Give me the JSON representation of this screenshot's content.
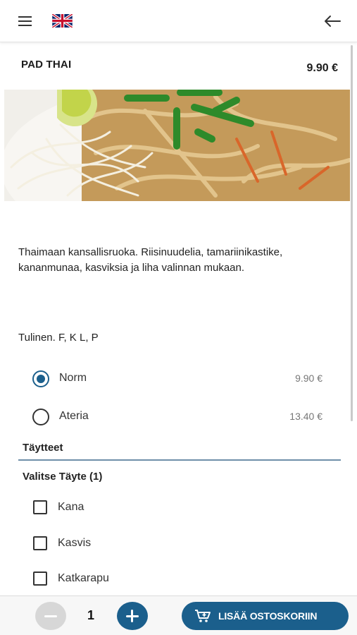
{
  "header": {
    "menu_icon": "hamburger-menu-icon",
    "language_icon": "uk-flag-icon",
    "back_icon": "arrow-left-icon"
  },
  "product": {
    "name": "PAD THAI",
    "price": "9.90 €",
    "description": "Thaimaan kansallisruoka. Riisinuudelia, tamariinikastike, kananmunaa, kasviksia ja liha valinnan mukaan.",
    "allergens": "Tulinen. F, K L, P"
  },
  "options": [
    {
      "label": "Norm",
      "price": "9.90 €",
      "selected": true
    },
    {
      "label": "Ateria",
      "price": "13.40 €",
      "selected": false
    }
  ],
  "fillings": {
    "section_title": "Täytteet",
    "group_title": "Valitse Täyte (1)",
    "items": [
      {
        "label": "Kana",
        "checked": false
      },
      {
        "label": "Kasvis",
        "checked": false
      },
      {
        "label": "Katkarapu",
        "checked": false
      }
    ]
  },
  "footer": {
    "quantity": "1",
    "add_to_cart_label": "LISÄÄ OSTOSKORIIN"
  },
  "colors": {
    "accent": "#1b5f8c",
    "disabled": "#d7d7d7"
  }
}
